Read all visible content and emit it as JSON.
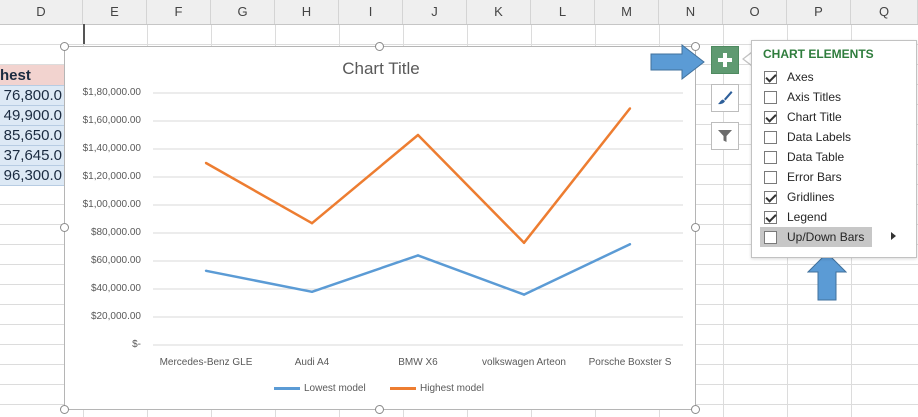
{
  "sheet": {
    "columns": [
      "D",
      "E",
      "F",
      "G",
      "H",
      "I",
      "J",
      "K",
      "L",
      "M",
      "N",
      "O",
      "P",
      "Q"
    ],
    "d_column": {
      "header_text": "hest mod",
      "values": [
        "76,800.0",
        "49,900.0",
        "85,650.0",
        "37,645.0",
        "96,300.0"
      ]
    }
  },
  "chart": {
    "title": "Chart Title",
    "legend": [
      "Lowest model",
      "Highest model"
    ]
  },
  "chart_data": {
    "type": "line",
    "title": "Chart Title",
    "categories": [
      "Mercedes-Benz GLE",
      "Audi A4",
      "BMW X6",
      "volkswagen Arteon",
      "Porsche Boxster S"
    ],
    "y_tick_labels": [
      "$-",
      "$20,000.00",
      "$40,000.00",
      "$60,000.00",
      "$80,000.00",
      "$1,00,000.00",
      "$1,20,000.00",
      "$1,40,000.00",
      "$1,60,000.00",
      "$1,80,000.00"
    ],
    "ylim": [
      0,
      180000
    ],
    "grid": true,
    "legend_position": "bottom",
    "series": [
      {
        "name": "Lowest model",
        "color": "#5b9bd5",
        "values": [
          53000,
          38000,
          64000,
          36000,
          72000
        ]
      },
      {
        "name": "Highest model",
        "color": "#ed7d31",
        "values": [
          130000,
          87000,
          150000,
          73000,
          169000
        ]
      }
    ]
  },
  "chart_elements_panel": {
    "title": "CHART ELEMENTS",
    "items": [
      {
        "label": "Axes",
        "checked": true
      },
      {
        "label": "Axis Titles",
        "checked": false
      },
      {
        "label": "Chart Title",
        "checked": true
      },
      {
        "label": "Data Labels",
        "checked": false
      },
      {
        "label": "Data Table",
        "checked": false
      },
      {
        "label": "Error Bars",
        "checked": false
      },
      {
        "label": "Gridlines",
        "checked": true
      },
      {
        "label": "Legend",
        "checked": true
      },
      {
        "label": "Up/Down Bars",
        "checked": false
      }
    ]
  },
  "side_buttons": [
    "plus-icon",
    "brush-icon",
    "filter-icon"
  ],
  "colors": {
    "accent_green": "#5f9a71",
    "panel_title": "#2f7d3d",
    "callout_arrow": "#5b9bd5"
  }
}
